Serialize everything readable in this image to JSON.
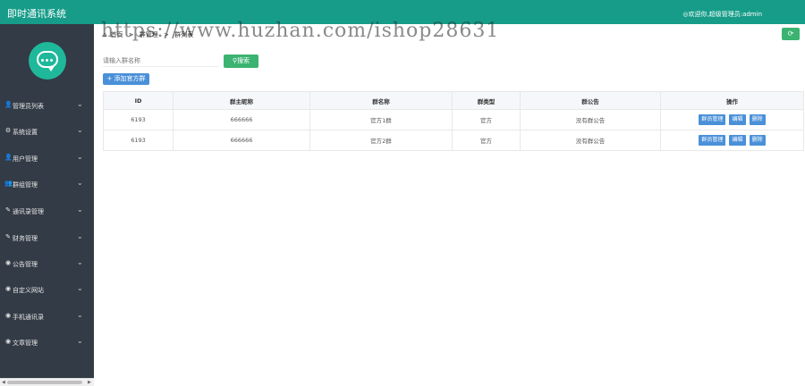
{
  "header": {
    "app_title": "即时通讯系统",
    "welcome_text": "◎欢迎你,超级管理员:admin"
  },
  "sidebar": {
    "logo": "chat-bubble-logo",
    "items": [
      {
        "label": "管理员列表",
        "icon": "user-icon"
      },
      {
        "label": "系统设置",
        "icon": "gear-icon"
      },
      {
        "label": "用户管理",
        "icon": "user-icon"
      },
      {
        "label": "群组管理",
        "icon": "users-icon"
      },
      {
        "label": "通讯录管理",
        "icon": "edit-icon"
      },
      {
        "label": "财务管理",
        "icon": "edit-icon"
      },
      {
        "label": "公告管理",
        "icon": "circle-icon"
      },
      {
        "label": "自定义网站",
        "icon": "circle-icon"
      },
      {
        "label": "手机通讯录",
        "icon": "circle-icon"
      },
      {
        "label": "文章管理",
        "icon": "circle-icon"
      }
    ]
  },
  "breadcrumb": {
    "home": "首页",
    "sep1": ">",
    "section": "群管理",
    "sep2": ">",
    "current": "群列表"
  },
  "toolbar": {
    "search_placeholder": "请输入群名称",
    "search_label": "搜索",
    "add_label": "添加官方群",
    "refresh_icon": "refresh-icon"
  },
  "watermark": "https://www.huzhan.com/ishop28631",
  "table": {
    "columns": [
      "ID",
      "群主昵称",
      "群名称",
      "群类型",
      "群公告",
      "操作"
    ],
    "rows": [
      {
        "id": "6193",
        "owner": "666666",
        "name": "官方1群",
        "type": "官方",
        "notice": "没有群公告"
      },
      {
        "id": "6193",
        "owner": "666666",
        "name": "官方2群",
        "type": "官方",
        "notice": "没有群公告"
      }
    ],
    "actions": {
      "manage": "群员管理",
      "edit": "编辑",
      "delete": "删除"
    }
  },
  "colors": {
    "topbar": "#169c89",
    "sidebar": "#333b46",
    "primary_button": "#4a90d9",
    "success_button": "#3cb371"
  }
}
